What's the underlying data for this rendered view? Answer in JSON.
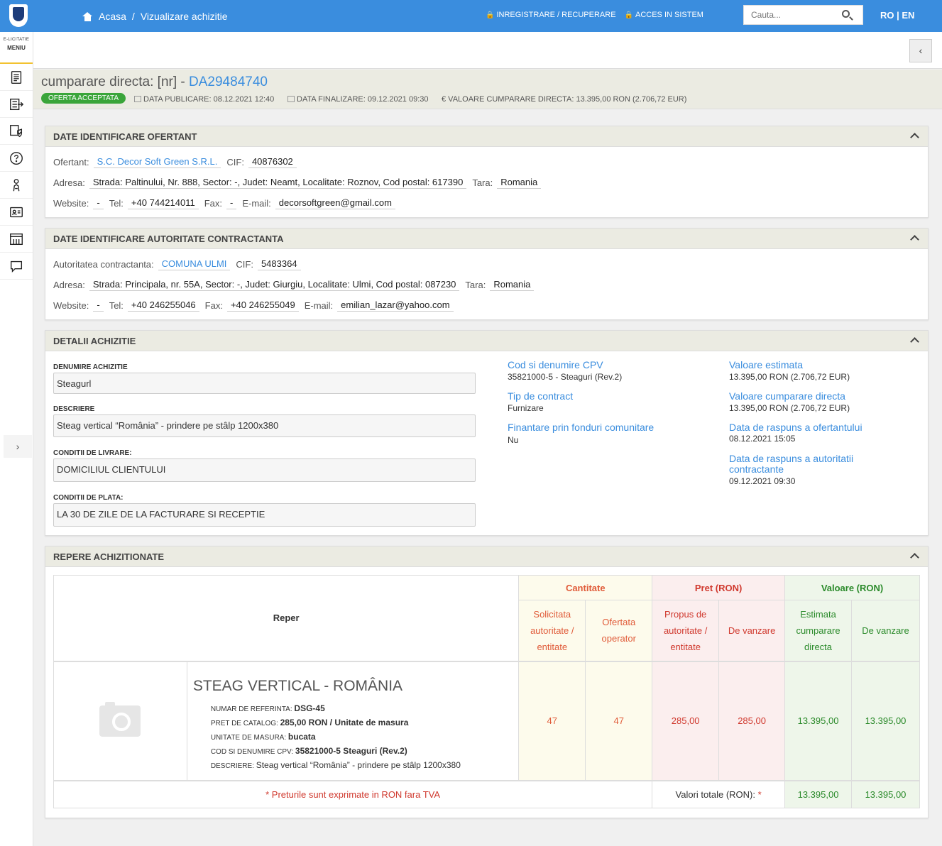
{
  "topbar": {
    "breadcrumb_home": "Acasa",
    "breadcrumb_sep": "/",
    "breadcrumb_current": "Vizualizare achizitie",
    "link_register": "INREGISTRARE / RECUPERARE",
    "link_login": "ACCES IN SISTEM",
    "search_placeholder": "Cauta...",
    "lang_ro": "RO",
    "lang_sep": "|",
    "lang_en": "EN"
  },
  "sidebar": {
    "brand": "E-LICITATIE",
    "menu_label": "MENIU",
    "items": [
      "document-icon",
      "list-export-icon",
      "shield-doc-icon",
      "help-icon",
      "user-touch-icon",
      "id-card-icon",
      "catalog-icon",
      "chat-icon"
    ]
  },
  "header": {
    "title_prefix": "cumparare directa: [nr] - ",
    "title_code": "DA29484740",
    "status": "OFERTA ACCEPTATA",
    "data_publicare_label": "DATA PUBLICARE:",
    "data_publicare": "08.12.2021 12:40",
    "data_finalizare_label": "DATA FINALIZARE:",
    "data_finalizare": "09.12.2021 09:30",
    "valoare_label": "€ VALOARE CUMPARARE DIRECTA:",
    "valoare": "13.395,00  RON (2.706,72  EUR)"
  },
  "ofertant": {
    "panel_title": "DATE IDENTIFICARE OFERTANT",
    "name_label": "Ofertant:",
    "name": "S.C. Decor Soft Green S.R.L.",
    "cif_label": "CIF:",
    "cif": "40876302",
    "address_label": "Adresa:",
    "address": "Strada: Paltinului, Nr. 888, Sector: -, Judet: Neamt, Localitate: Roznov, Cod postal: 617390",
    "country_label": "Tara:",
    "country": "Romania",
    "website_label": "Website:",
    "website": "-",
    "tel_label": "Tel:",
    "tel": "+40 744214011",
    "fax_label": "Fax:",
    "fax": "-",
    "email_label": "E-mail:",
    "email": "decorsoftgreen@gmail.com"
  },
  "autoritate": {
    "panel_title": "DATE IDENTIFICARE AUTORITATE CONTRACTANTA",
    "name_label": "Autoritatea contractanta:",
    "name": "COMUNA ULMI",
    "cif_label": "CIF:",
    "cif": "5483364",
    "address_label": "Adresa:",
    "address": "Strada: Principala, nr. 55A, Sector: -, Judet: Giurgiu, Localitate: Ulmi, Cod postal: 087230",
    "country_label": "Tara:",
    "country": "Romania",
    "website_label": "Website:",
    "website": "-",
    "tel_label": "Tel:",
    "tel": "+40 246255046",
    "fax_label": "Fax:",
    "fax": "+40 246255049",
    "email_label": "E-mail:",
    "email": "emilian_lazar@yahoo.com"
  },
  "detalii": {
    "panel_title": "DETALII ACHIZITIE",
    "denumire_label": "DENUMIRE ACHIZITIE",
    "denumire": "Steagurl",
    "descriere_label": "DESCRIERE",
    "descriere": "Steag vertical “România” - prindere pe stâlp 1200x380",
    "livrare_label": "CONDITII DE LIVRARE:",
    "livrare": "DOMICILIUL CLIENTULUI",
    "plata_label": "CONDITII DE PLATA:",
    "plata": "LA 30 DE ZILE DE LA FACTURARE SI RECEPTIE",
    "cpv_title": "Cod si denumire CPV",
    "cpv": "35821000-5 - Steaguri (Rev.2)",
    "tip_title": "Tip de contract",
    "tip": "Furnizare",
    "fonduri_title": "Finantare prin fonduri comunitare",
    "fonduri": "Nu",
    "val_est_title": "Valoare estimata",
    "val_est": "13.395,00  RON (2.706,72  EUR)",
    "val_cd_title": "Valoare cumparare directa",
    "val_cd": "13.395,00  RON (2.706,72  EUR)",
    "raspuns_of_title": "Data de raspuns a ofertantului",
    "raspuns_of": "08.12.2021 15:05",
    "raspuns_aut_title": "Data de raspuns a autoritatii contractante",
    "raspuns_aut": "09.12.2021 09:30"
  },
  "repere": {
    "panel_title": "REPERE ACHIZITIONATE",
    "col_reper": "Reper",
    "grp_cantitate": "Cantitate",
    "grp_pret": "Pret (RON)",
    "grp_valoare": "Valoare (RON)",
    "sub_solicitata": "Solicitata autoritate / entitate",
    "sub_ofertata": "Ofertata operator",
    "sub_propus": "Propus de autoritate / entitate",
    "sub_vanzare_pret": "De vanzare",
    "sub_estimata": "Estimata cumparare directa",
    "sub_vanzare_val": "De vanzare",
    "item": {
      "title": "STEAG VERTICAL - ROMÂNIA",
      "ref_label": "NUMAR DE REFERINTA:",
      "ref": "DSG-45",
      "pret_label": "PRET DE CATALOG:",
      "pret": "285,00  RON / Unitate de masura",
      "um_label": "UNITATE DE MASURA:",
      "um": "bucata",
      "cpv_label": "COD SI DENUMIRE CPV:",
      "cpv": "35821000-5 Steaguri (Rev.2)",
      "desc_label": "DESCRIERE:",
      "desc": "Steag vertical “România” - prindere pe stâlp 1200x380",
      "solicitata": "47",
      "ofertata": "47",
      "propus": "285,00",
      "vanzare_pret": "285,00",
      "estimata": "13.395,00",
      "vanzare_val": "13.395,00"
    },
    "note": "* Preturile sunt exprimate in RON fara TVA",
    "totals_label": "Valori totale (RON):",
    "totals_star": "*",
    "total_estimata": "13.395,00",
    "total_vanzare": "13.395,00"
  }
}
